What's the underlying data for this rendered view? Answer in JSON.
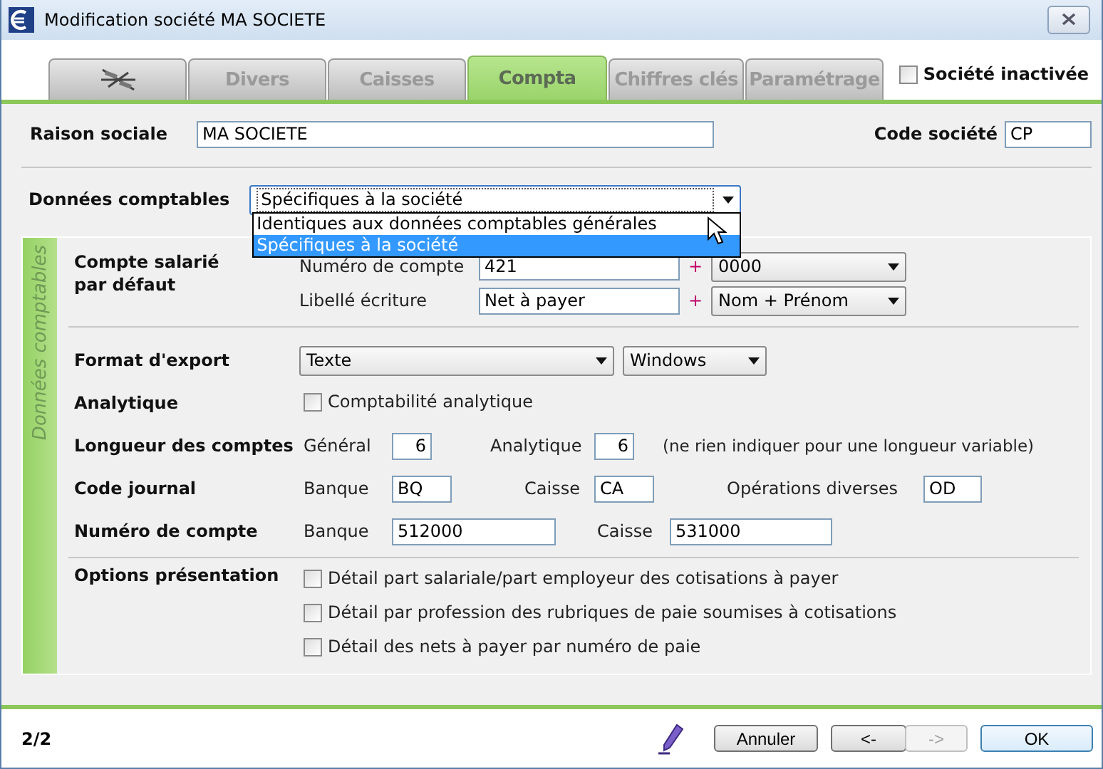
{
  "window": {
    "title": "Modification société MA SOCIETE"
  },
  "tabs": [
    {
      "kind": "icon",
      "selected": false
    },
    {
      "kind": "text",
      "label": "Divers",
      "selected": false
    },
    {
      "kind": "text",
      "label": "Caisses",
      "selected": false
    },
    {
      "kind": "text",
      "label": "Compta",
      "selected": true
    },
    {
      "kind": "text",
      "label": "Chiffres clés",
      "selected": false
    },
    {
      "kind": "text",
      "label": "Paramétrage",
      "selected": false
    }
  ],
  "inactive_checkbox": {
    "label": "Société inactivée",
    "checked": false
  },
  "raison_sociale": {
    "label": "Raison sociale",
    "value": "MA SOCIETE"
  },
  "code_societe": {
    "label": "Code société",
    "value": "CP"
  },
  "donnees_comptables": {
    "label": "Données comptables",
    "value": "Spécifiques à la société",
    "expanded": true,
    "options": [
      {
        "label": "Identiques aux données comptables générales",
        "selected": false
      },
      {
        "label": "Spécifiques à la société",
        "selected": true
      }
    ]
  },
  "panel": {
    "side_label": "Données comptables"
  },
  "compte_salarie": {
    "label": "Compte salarié par défaut",
    "rows": [
      {
        "label": "Numéro de compte",
        "value": "421",
        "plus": "+",
        "select": "0000"
      },
      {
        "label": "Libellé écriture",
        "value": "Net à payer",
        "plus": "+",
        "select": "Nom + Prénom"
      }
    ]
  },
  "format_export": {
    "label": "Format d'export",
    "format": "Texte",
    "encoding": "Windows"
  },
  "analytique": {
    "label": "Analytique",
    "checkbox": {
      "label": "Comptabilité analytique",
      "checked": false
    }
  },
  "longueur_comptes": {
    "label": "Longueur des comptes",
    "fields": [
      {
        "label": "Général",
        "value": "6"
      },
      {
        "label": "Analytique",
        "value": "6"
      }
    ],
    "note": "(ne rien indiquer pour une longueur variable)"
  },
  "code_journal": {
    "label": "Code journal",
    "fields": [
      {
        "label": "Banque",
        "value": "BQ"
      },
      {
        "label": "Caisse",
        "value": "CA"
      },
      {
        "label": "Opérations diverses",
        "value": "OD"
      }
    ]
  },
  "numero_compte": {
    "label": "Numéro de compte",
    "fields": [
      {
        "label": "Banque",
        "value": "512000"
      },
      {
        "label": "Caisse",
        "value": "531000"
      }
    ]
  },
  "options_presentation": {
    "label": "Options présentation",
    "options": [
      {
        "label": "Détail part salariale/part employeur des cotisations à payer",
        "checked": false
      },
      {
        "label": "Détail par profession des rubriques de paie soumises à cotisations",
        "checked": false
      },
      {
        "label": "Détail des nets à payer par numéro de paie",
        "checked": false
      }
    ]
  },
  "footer": {
    "page": "2/2",
    "buttons": [
      {
        "label": "Annuler",
        "disabled": false,
        "default": false
      },
      {
        "label": "<-",
        "disabled": false,
        "default": false
      },
      {
        "label": "->",
        "disabled": true,
        "default": false
      },
      {
        "label": "OK",
        "disabled": false,
        "default": true
      }
    ]
  }
}
